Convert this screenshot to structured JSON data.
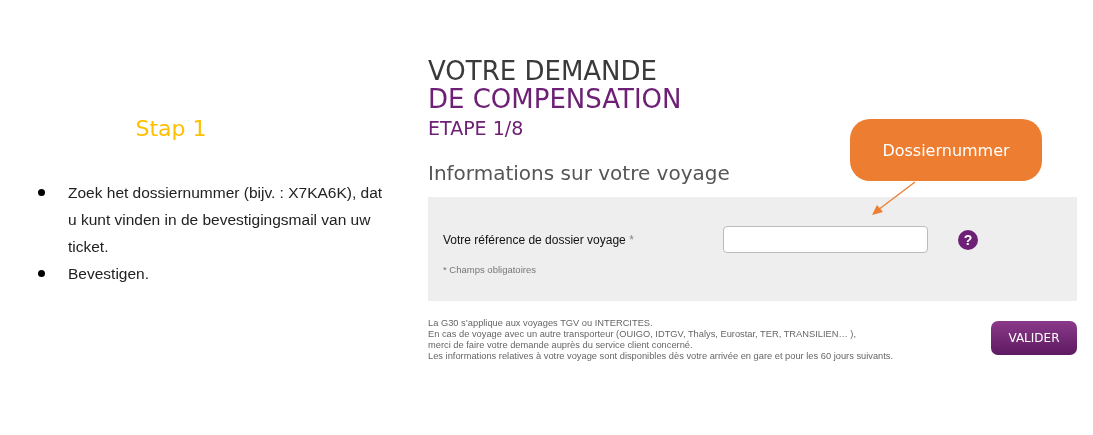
{
  "slide_title": "Stap 1",
  "instructions": [
    "Zoek het dossiernummer (bijv. : X7KA6K), dat u kunt vinden in de bevestigingsmail van uw ticket.",
    "Bevestigen."
  ],
  "page": {
    "title_lines": [
      {
        "text": "VOTRE DEMANDE",
        "kind": "main"
      },
      {
        "text": "DE COMPENSATION",
        "kind": "accent"
      },
      {
        "text": "ETAPE 1/8",
        "kind": "step"
      }
    ],
    "section_heading": "Informations sur votre voyage",
    "form": {
      "label": "Votre référence de dossier voyage",
      "required_mark": "*",
      "help": "?",
      "required_note": "* Champs obligatoires"
    },
    "notes": [
      "La G30 s’applique aux voyages TGV ou INTERCITES.",
      "En cas de voyage avec un autre transporteur (OUIGO, IDTGV, Thalys, Eurostar, TER, TRANSILIEN… ),",
      "merci de faire votre demande auprès du service client concerné.",
      "Les informations relatives à votre voyage sont disponibles dès votre arrivée en gare et pour les 60 jours suivants."
    ],
    "submit_button": "VALIDER"
  },
  "callout": {
    "text": "Dossiernummer"
  }
}
